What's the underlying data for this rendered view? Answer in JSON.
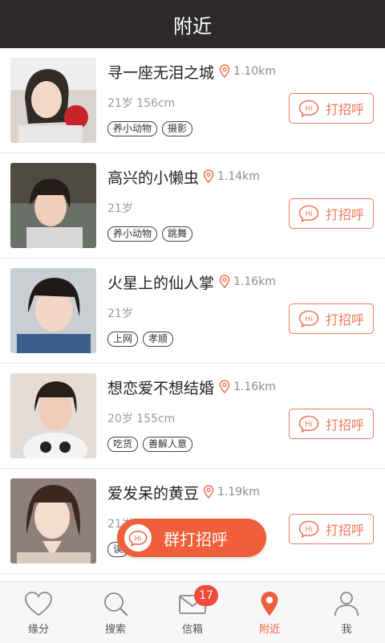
{
  "header": {
    "title": "附近"
  },
  "colors": {
    "accent": "#ef5f3b",
    "header_bg": "#2e2a2b",
    "button_border": "#f0775a"
  },
  "users": [
    {
      "name": "寻一座无泪之城",
      "distance": "1.10km",
      "meta": "21岁 156cm",
      "tags": [
        "养小动物",
        "摄影"
      ],
      "button_label": "打招呼"
    },
    {
      "name": "高兴的小懒虫",
      "distance": "1.14km",
      "meta": "21岁",
      "tags": [
        "养小动物",
        "跳舞"
      ],
      "button_label": "打招呼"
    },
    {
      "name": "火星上的仙人掌",
      "distance": "1.16km",
      "meta": "21岁",
      "tags": [
        "上网",
        "孝顺"
      ],
      "button_label": "打招呼"
    },
    {
      "name": "想恋爱不想结婚",
      "distance": "1.16km",
      "meta": "20岁 155cm",
      "tags": [
        "吃货",
        "善解人意"
      ],
      "button_label": "打招呼"
    },
    {
      "name": "爱发呆的黄豆",
      "distance": "1.19km",
      "meta": "21岁",
      "tags": [
        "读"
      ],
      "button_label": "打招呼"
    }
  ],
  "hi_icon_text": "Hi",
  "group_button": {
    "label": "群打招呼",
    "icon_text": "Hi"
  },
  "tabs": [
    {
      "label": "缘分",
      "icon": "heart-icon"
    },
    {
      "label": "搜索",
      "icon": "search-icon"
    },
    {
      "label": "信箱",
      "icon": "mail-icon",
      "badge": "17"
    },
    {
      "label": "附近",
      "icon": "location-pin-icon",
      "active": true
    },
    {
      "label": "我",
      "icon": "user-icon"
    }
  ]
}
